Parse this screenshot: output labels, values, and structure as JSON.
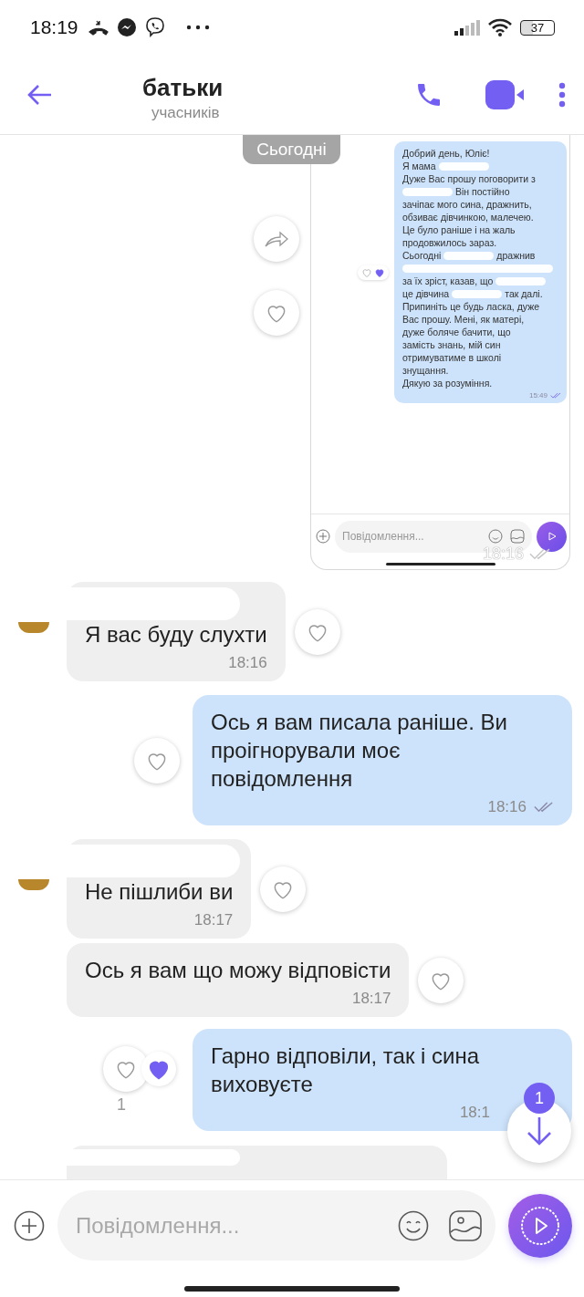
{
  "status_bar": {
    "time": "18:19",
    "battery": "37"
  },
  "header": {
    "title": "батьки",
    "subtitle": "учасників"
  },
  "shared_screenshot": {
    "date_label": "Сьогодні",
    "time": "18:16",
    "read": true,
    "reacted": false,
    "message": {
      "time": "15:49",
      "read": true,
      "reacted": true,
      "lines": [
        [
          {
            "kind": "text",
            "text": "Добрий день, Юліє!"
          }
        ],
        [
          {
            "kind": "text",
            "text": "Я мама"
          },
          {
            "kind": "redacted"
          }
        ],
        [
          {
            "kind": "text",
            "text": "Дуже Вас прошу поговорити з"
          }
        ],
        [
          {
            "kind": "redacted"
          },
          {
            "kind": "text",
            "text": "Він постійно"
          }
        ],
        [
          {
            "kind": "text",
            "text": "зачіпає мого сина, дражнить,"
          }
        ],
        [
          {
            "kind": "text",
            "text": "обзиває дівчинкою, малечею."
          }
        ],
        [
          {
            "kind": "text",
            "text": "Це було раніше і на жаль"
          }
        ],
        [
          {
            "kind": "text",
            "text": "продовжилось зараз."
          }
        ],
        [
          {
            "kind": "text",
            "text": "Сьогодні"
          },
          {
            "kind": "redacted"
          },
          {
            "kind": "text",
            "text": "дражнив"
          }
        ],
        [
          {
            "kind": "redacted"
          }
        ],
        [
          {
            "kind": "text",
            "text": "за їх зріст, казав, що"
          },
          {
            "kind": "redacted"
          }
        ],
        [
          {
            "kind": "text",
            "text": "це дівчина"
          },
          {
            "kind": "redacted"
          },
          {
            "kind": "text",
            "text": "так далі."
          }
        ],
        [
          {
            "kind": "text",
            "text": "Припиніть це будь ласка, дуже"
          }
        ],
        [
          {
            "kind": "text",
            "text": "Вас прошу. Мені, як матері,"
          }
        ],
        [
          {
            "kind": "text",
            "text": "дуже боляче бачити, що"
          }
        ],
        [
          {
            "kind": "text",
            "text": "замість знань, мій син"
          }
        ],
        [
          {
            "kind": "text",
            "text": "отримуватиме в школі"
          }
        ],
        [
          {
            "kind": "text",
            "text": "знущання."
          }
        ],
        [
          {
            "kind": "text",
            "text": "Дякую за розуміння."
          }
        ]
      ]
    },
    "composer_placeholder": "Повідомлення..."
  },
  "messages": [
    {
      "kind": "incoming",
      "text": "Я вас буду слухти",
      "time": "18:16",
      "sender_redacted": true,
      "reacted": false
    },
    {
      "kind": "outgoing",
      "text": "Ось я вам писала раніше. Ви проігнорували моє повідомлення",
      "time": "18:16",
      "read": true,
      "reacted": false
    },
    {
      "kind": "incoming",
      "text": "Не пішлиби ви",
      "time": "18:17",
      "sender_redacted": true,
      "reacted": false
    },
    {
      "kind": "incoming",
      "text": "Ось я вам що можу відповісти",
      "time": "18:17",
      "sender_redacted": false,
      "reacted": false
    },
    {
      "kind": "outgoing",
      "text": "Гарно відповіли, так і сина виховуєте",
      "time": "18:1",
      "reacted": true,
      "reaction_count": "1"
    },
    {
      "kind": "partial",
      "sender_redacted": true
    }
  ],
  "scroll_button": {
    "badge": "1"
  },
  "composer": {
    "placeholder": "Повідомлення..."
  }
}
